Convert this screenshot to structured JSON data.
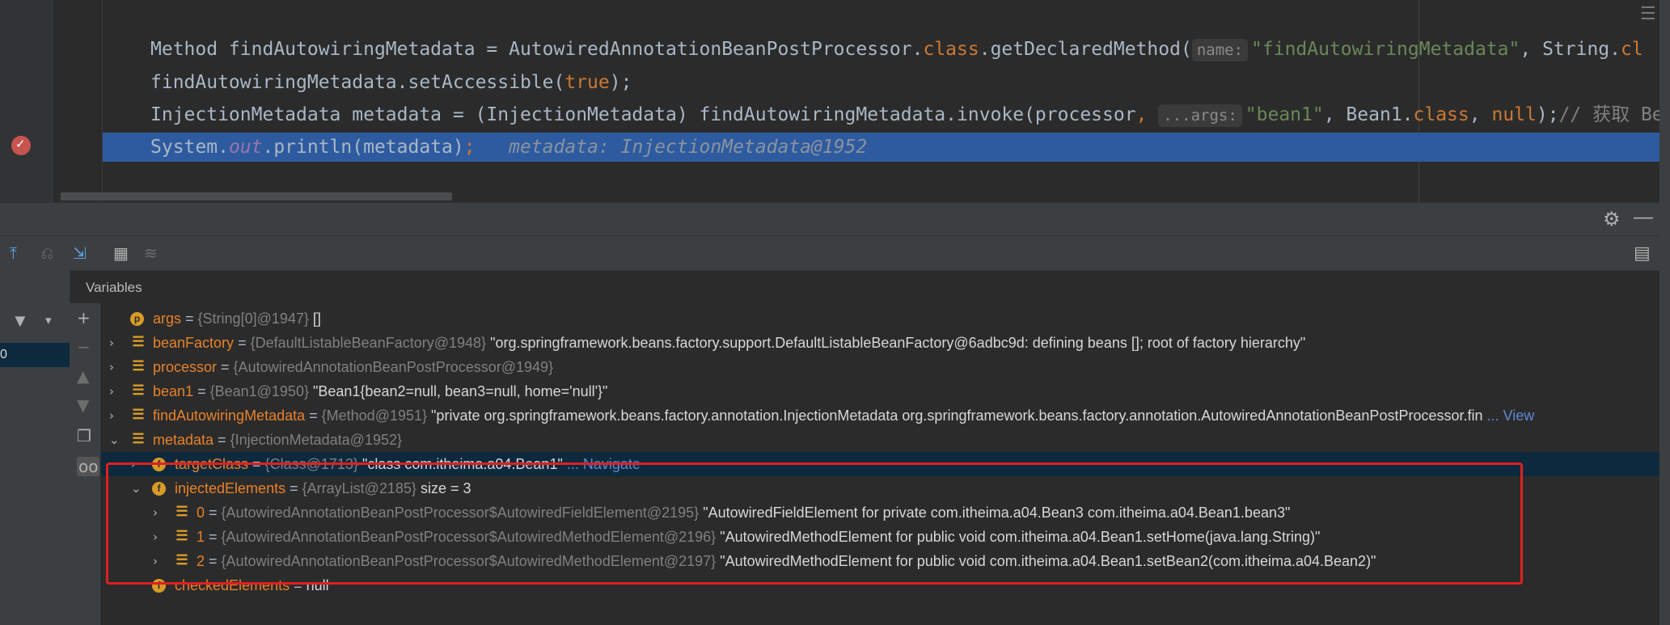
{
  "editor": {
    "lines": [
      {
        "segments": [
          {
            "t": "Method findAutowiringMetadata = AutowiredAnnotationBeanPostProcessor.",
            "c": "plain"
          },
          {
            "t": "class",
            "c": "kw"
          },
          {
            "t": ".getDeclaredMethod(",
            "c": "plain"
          },
          {
            "t": "name:",
            "c": "hint"
          },
          {
            "t": "\"findAutowiringMetadata\"",
            "c": "str"
          },
          {
            "t": ", String.",
            "c": "plain"
          },
          {
            "t": "cl",
            "c": "kw"
          }
        ]
      },
      {
        "segments": [
          {
            "t": "findAutowiringMetadata.setAccessible(",
            "c": "plain"
          },
          {
            "t": "true",
            "c": "kw"
          },
          {
            "t": ");",
            "c": "plain"
          }
        ]
      },
      {
        "segments": [
          {
            "t": "InjectionMetadata metadata = (InjectionMetadata) findAutowiringMetadata.invoke(processor",
            "c": "plain"
          },
          {
            "t": ",",
            "c": "kw"
          },
          {
            "t": " ",
            "c": "plain"
          },
          {
            "t": "...args:",
            "c": "hint"
          },
          {
            "t": "\"bean1\"",
            "c": "str"
          },
          {
            "t": ", Bean1.",
            "c": "plain"
          },
          {
            "t": "class",
            "c": "kw"
          },
          {
            "t": ", ",
            "c": "plain"
          },
          {
            "t": "null",
            "c": "kw"
          },
          {
            "t": ");",
            "c": "plain"
          },
          {
            "t": "// 获取 Be",
            "c": "comment"
          }
        ]
      },
      {
        "segments": [
          {
            "t": "System.",
            "c": "plain"
          },
          {
            "t": "out",
            "c": "field"
          },
          {
            "t": ".println(metadata)",
            "c": "plain"
          },
          {
            "t": ";",
            "c": "kw"
          },
          {
            "t": "   metadata: InjectionMetadata@1952",
            "c": "inline-val"
          }
        ]
      }
    ]
  },
  "panel": {
    "variables_title": "Variables"
  },
  "variables": [
    {
      "arrow": "",
      "icon": "p",
      "indent": 0,
      "name": "args",
      "type": "{String[0]@1947}",
      "value": "[]",
      "link": ""
    },
    {
      "arrow": "›",
      "icon": "bars",
      "indent": 0,
      "name": "beanFactory",
      "type": "{DefaultListableBeanFactory@1948}",
      "value": "\"org.springframework.beans.factory.support.DefaultListableBeanFactory@6adbc9d: defining beans []; root of factory hierarchy\"",
      "link": ""
    },
    {
      "arrow": "›",
      "icon": "bars",
      "indent": 0,
      "name": "processor",
      "type": "{AutowiredAnnotationBeanPostProcessor@1949}",
      "value": "",
      "link": ""
    },
    {
      "arrow": "›",
      "icon": "bars",
      "indent": 0,
      "name": "bean1",
      "type": "{Bean1@1950}",
      "value": "\"Bean1{bean2=null, bean3=null, home='null'}\"",
      "link": ""
    },
    {
      "arrow": "›",
      "icon": "bars",
      "indent": 0,
      "name": "findAutowiringMetadata",
      "type": "{Method@1951}",
      "value": "\"private org.springframework.beans.factory.annotation.InjectionMetadata org.springframework.beans.factory.annotation.AutowiredAnnotationBeanPostProcessor.fin",
      "link": "... View"
    },
    {
      "arrow": "⌄",
      "icon": "bars",
      "indent": 0,
      "name": "metadata",
      "type": "{InjectionMetadata@1952}",
      "value": "",
      "link": ""
    },
    {
      "arrow": "›",
      "icon": "f",
      "indent": 1,
      "name": "targetClass",
      "type": "{Class@1713}",
      "value": "\"class com.itheima.a04.Bean1\"",
      "link": "... Navigate"
    },
    {
      "arrow": "⌄",
      "icon": "f",
      "indent": 1,
      "name": "injectedElements",
      "type": "{ArrayList@2185}",
      "value": " size = 3",
      "link": ""
    },
    {
      "arrow": "›",
      "icon": "bars",
      "indent": 2,
      "name": "0",
      "type": "{AutowiredAnnotationBeanPostProcessor$AutowiredFieldElement@2195}",
      "value": "\"AutowiredFieldElement for private com.itheima.a04.Bean3 com.itheima.a04.Bean1.bean3\"",
      "link": ""
    },
    {
      "arrow": "›",
      "icon": "bars",
      "indent": 2,
      "name": "1",
      "type": "{AutowiredAnnotationBeanPostProcessor$AutowiredMethodElement@2196}",
      "value": "\"AutowiredMethodElement for public void com.itheima.a04.Bean1.setHome(java.lang.String)\"",
      "link": ""
    },
    {
      "arrow": "›",
      "icon": "bars",
      "indent": 2,
      "name": "2",
      "type": "{AutowiredAnnotationBeanPostProcessor$AutowiredMethodElement@2197}",
      "value": "\"AutowiredMethodElement for public void com.itheima.a04.Bean1.setBean2(com.itheima.a04.Bean2)\"",
      "link": ""
    },
    {
      "arrow": "",
      "icon": "f",
      "indent": 1,
      "name": "checkedElements",
      "type": "",
      "value": "null",
      "link": ""
    }
  ],
  "colors": {
    "accent_selection": "#2e5b9f",
    "highlight_box": "#e02020",
    "var_name": "#e8822a"
  }
}
